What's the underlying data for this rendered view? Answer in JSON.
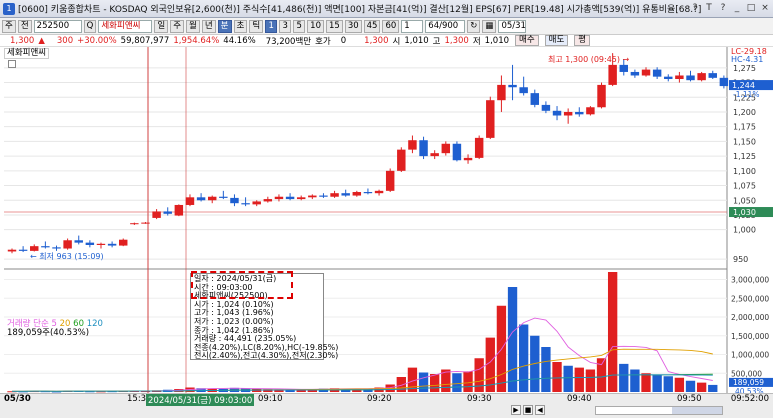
{
  "window": {
    "title": "[0600] 키움종합차트 - KOSDAQ 외국인보유[2,600(천)] 주식수[41,486(천)] 액면[100] 자본금[41(억)] 결산[12월] EPS[67] PER[19.48] 시가총액[539(억)] 유통비율[68.?]",
    "buttons": [
      "?",
      "T",
      "?",
      "_",
      "□",
      "×"
    ]
  },
  "toolbar": {
    "type_label": "주",
    "market_label": "전",
    "code": "252500",
    "q_label": "Q",
    "name": "세화피앤씨",
    "periods": [
      "일",
      "주",
      "월",
      "년",
      "분",
      "초",
      "틱"
    ],
    "active_period": "분",
    "intervals": [
      "1",
      "3",
      "5",
      "10",
      "15",
      "30",
      "45",
      "60"
    ],
    "interval_value": "1",
    "count": "64/900",
    "date": "05/31"
  },
  "quote": {
    "price": "1,300",
    "change": "300",
    "change_pct": "+30.00%",
    "volume": "59,807,977",
    "volume_pct": "1,954.64%",
    "turnover": "44.16%",
    "amount": "73,200백만",
    "hoga_label": "호가",
    "hoga_value": "0",
    "hoga_price": "1,300",
    "open_label": "시",
    "open": "1,010",
    "high_label": "고",
    "high": "1,300",
    "low_label": "저",
    "low": "1,010",
    "buy_label": "매수",
    "sell_label": "매도",
    "eval_label": "평"
  },
  "chart_labels": {
    "legend_name": "세화피앤씨",
    "high_annotation": "최고 1,300 (09:45)",
    "low_annotation": "최저 963 (15:09)",
    "lc_label": "LC-29.18",
    "hc_label": "HC-4.31",
    "current_price": "1,244",
    "current_pct": "-1.11%",
    "ref_price": "1,030",
    "vol_legend_a": "거래량",
    "vol_legend_b": "단순",
    "vol_legend_c": "5",
    "vol_legend_d": "20",
    "vol_legend_e": "60",
    "vol_legend_f": "120",
    "vol_legend_value": "189,059주(40.53%)",
    "vol_current": "189,059",
    "vol_current_pct": "40.53%"
  },
  "tooltip": {
    "date": "일자      : 2024/05/31(금)",
    "time": "시간      : 09:03:00",
    "name": "세화피앤씨(252500)",
    "open": "시가      : 1,024 (0.10%)",
    "high": "고가      : 1,043 (1.96%)",
    "low": "저가      : 1,023 (0.00%)",
    "close": "종가      : 1,042 (1.86%)",
    "volume": "거래량    : 44,491 (235.05%)",
    "extra1": "전종(4.20%),LC(8.20%),HC(-19.85%)",
    "extra2": "전시(2.40%),전고(4.30%),전저(2.30%)"
  },
  "time_axis": {
    "date_label": "05/30",
    "labels": [
      "15:30",
      "09:10",
      "09:20",
      "09:30",
      "09:40",
      "09:50"
    ],
    "highlight": "2024/05/31(금) 09:03:00",
    "end_time": "09:52:00"
  },
  "chart_data": [
    {
      "type": "candlestick",
      "title": "",
      "y_ticks": [
        950,
        1000,
        1025,
        1050,
        1075,
        1100,
        1125,
        1150,
        1175,
        1200,
        1225,
        1250,
        1275
      ],
      "ylim": [
        940,
        1290
      ],
      "colors": {
        "up": "#e02020",
        "down": "#1e5fd0"
      },
      "candles": [
        {
          "o": 963,
          "h": 968,
          "l": 960,
          "c": 966
        },
        {
          "o": 966,
          "h": 972,
          "l": 962,
          "c": 964
        },
        {
          "o": 964,
          "h": 975,
          "l": 963,
          "c": 972
        },
        {
          "o": 972,
          "h": 980,
          "l": 968,
          "c": 970
        },
        {
          "o": 970,
          "h": 973,
          "l": 964,
          "c": 968
        },
        {
          "o": 968,
          "h": 985,
          "l": 966,
          "c": 982
        },
        {
          "o": 982,
          "h": 990,
          "l": 975,
          "c": 978
        },
        {
          "o": 978,
          "h": 982,
          "l": 970,
          "c": 974
        },
        {
          "o": 974,
          "h": 978,
          "l": 968,
          "c": 976
        },
        {
          "o": 976,
          "h": 980,
          "l": 970,
          "c": 973
        },
        {
          "o": 973,
          "h": 985,
          "l": 972,
          "c": 983
        },
        {
          "o": 1010,
          "h": 1012,
          "l": 1008,
          "c": 1011
        },
        {
          "o": 1011,
          "h": 1013,
          "l": 1010,
          "c": 1012
        },
        {
          "o": 1020,
          "h": 1035,
          "l": 1018,
          "c": 1031
        },
        {
          "o": 1031,
          "h": 1038,
          "l": 1024,
          "c": 1027
        },
        {
          "o": 1024,
          "h": 1043,
          "l": 1023,
          "c": 1042
        },
        {
          "o": 1042,
          "h": 1060,
          "l": 1040,
          "c": 1055
        },
        {
          "o": 1055,
          "h": 1062,
          "l": 1048,
          "c": 1050
        },
        {
          "o": 1050,
          "h": 1058,
          "l": 1045,
          "c": 1056
        },
        {
          "o": 1056,
          "h": 1066,
          "l": 1052,
          "c": 1054
        },
        {
          "o": 1054,
          "h": 1060,
          "l": 1040,
          "c": 1045
        },
        {
          "o": 1045,
          "h": 1055,
          "l": 1040,
          "c": 1043
        },
        {
          "o": 1043,
          "h": 1050,
          "l": 1040,
          "c": 1048
        },
        {
          "o": 1048,
          "h": 1056,
          "l": 1046,
          "c": 1052
        },
        {
          "o": 1052,
          "h": 1060,
          "l": 1048,
          "c": 1056
        },
        {
          "o": 1056,
          "h": 1062,
          "l": 1050,
          "c": 1052
        },
        {
          "o": 1052,
          "h": 1058,
          "l": 1050,
          "c": 1055
        },
        {
          "o": 1055,
          "h": 1060,
          "l": 1052,
          "c": 1058
        },
        {
          "o": 1058,
          "h": 1062,
          "l": 1054,
          "c": 1056
        },
        {
          "o": 1056,
          "h": 1066,
          "l": 1054,
          "c": 1062
        },
        {
          "o": 1062,
          "h": 1068,
          "l": 1056,
          "c": 1058
        },
        {
          "o": 1058,
          "h": 1066,
          "l": 1056,
          "c": 1064
        },
        {
          "o": 1064,
          "h": 1070,
          "l": 1060,
          "c": 1062
        },
        {
          "o": 1062,
          "h": 1068,
          "l": 1058,
          "c": 1066
        },
        {
          "o": 1066,
          "h": 1104,
          "l": 1064,
          "c": 1100
        },
        {
          "o": 1100,
          "h": 1140,
          "l": 1098,
          "c": 1136
        },
        {
          "o": 1136,
          "h": 1160,
          "l": 1130,
          "c": 1152
        },
        {
          "o": 1152,
          "h": 1158,
          "l": 1120,
          "c": 1125
        },
        {
          "o": 1125,
          "h": 1135,
          "l": 1120,
          "c": 1130
        },
        {
          "o": 1130,
          "h": 1150,
          "l": 1126,
          "c": 1146
        },
        {
          "o": 1146,
          "h": 1150,
          "l": 1116,
          "c": 1118
        },
        {
          "o": 1118,
          "h": 1128,
          "l": 1112,
          "c": 1122
        },
        {
          "o": 1122,
          "h": 1160,
          "l": 1120,
          "c": 1156
        },
        {
          "o": 1156,
          "h": 1226,
          "l": 1154,
          "c": 1220
        },
        {
          "o": 1220,
          "h": 1262,
          "l": 1200,
          "c": 1246
        },
        {
          "o": 1246,
          "h": 1280,
          "l": 1220,
          "c": 1242
        },
        {
          "o": 1242,
          "h": 1260,
          "l": 1228,
          "c": 1232
        },
        {
          "o": 1232,
          "h": 1238,
          "l": 1208,
          "c": 1212
        },
        {
          "o": 1212,
          "h": 1218,
          "l": 1198,
          "c": 1202
        },
        {
          "o": 1202,
          "h": 1210,
          "l": 1186,
          "c": 1194
        },
        {
          "o": 1194,
          "h": 1206,
          "l": 1180,
          "c": 1200
        },
        {
          "o": 1200,
          "h": 1208,
          "l": 1192,
          "c": 1196
        },
        {
          "o": 1196,
          "h": 1210,
          "l": 1194,
          "c": 1208
        },
        {
          "o": 1208,
          "h": 1250,
          "l": 1206,
          "c": 1246
        },
        {
          "o": 1246,
          "h": 1300,
          "l": 1244,
          "c": 1280
        },
        {
          "o": 1280,
          "h": 1290,
          "l": 1262,
          "c": 1268
        },
        {
          "o": 1268,
          "h": 1272,
          "l": 1258,
          "c": 1262
        },
        {
          "o": 1262,
          "h": 1276,
          "l": 1260,
          "c": 1272
        },
        {
          "o": 1272,
          "h": 1276,
          "l": 1256,
          "c": 1260
        },
        {
          "o": 1260,
          "h": 1264,
          "l": 1252,
          "c": 1256
        },
        {
          "o": 1256,
          "h": 1268,
          "l": 1250,
          "c": 1262
        },
        {
          "o": 1262,
          "h": 1270,
          "l": 1252,
          "c": 1254
        },
        {
          "o": 1254,
          "h": 1268,
          "l": 1252,
          "c": 1266
        },
        {
          "o": 1266,
          "h": 1270,
          "l": 1256,
          "c": 1258
        },
        {
          "o": 1258,
          "h": 1262,
          "l": 1240,
          "c": 1244
        }
      ]
    },
    {
      "type": "bar",
      "title": "거래량",
      "y_ticks": [
        500000,
        1000000,
        1500000,
        2000000,
        2500000,
        3000000
      ],
      "y_tick_labels": [
        "500,000",
        "1,000,000",
        "1,500,000",
        "2,000,000",
        "2,500,000",
        "3,000,000"
      ],
      "ylim": [
        0,
        3200000
      ],
      "values": [
        20000,
        18000,
        25000,
        22000,
        15000,
        30000,
        28000,
        20000,
        18000,
        22000,
        26000,
        30000,
        25000,
        44491,
        60000,
        80000,
        120000,
        100000,
        90000,
        85000,
        110000,
        95000,
        80000,
        75000,
        70000,
        65000,
        70000,
        80000,
        90000,
        100000,
        85000,
        90000,
        80000,
        120000,
        200000,
        400000,
        650000,
        520000,
        480000,
        600000,
        500000,
        550000,
        900000,
        1450000,
        2300000,
        2800000,
        1800000,
        1500000,
        1200000,
        800000,
        700000,
        650000,
        600000,
        900000,
        3200000,
        750000,
        600000,
        500000,
        450000,
        420000,
        380000,
        300000,
        250000,
        189059
      ],
      "up": [
        1,
        0,
        1,
        0,
        0,
        1,
        0,
        0,
        1,
        0,
        1,
        1,
        1,
        1,
        0,
        1,
        1,
        0,
        1,
        0,
        0,
        0,
        1,
        1,
        1,
        0,
        1,
        1,
        0,
        1,
        0,
        1,
        0,
        1,
        1,
        1,
        1,
        0,
        1,
        1,
        0,
        1,
        1,
        1,
        1,
        0,
        0,
        0,
        0,
        1,
        0,
        1,
        1,
        1,
        1,
        0,
        0,
        1,
        0,
        0,
        1,
        0,
        1,
        0
      ],
      "ma_series": [
        {
          "name": "5",
          "color": "#e060e0"
        },
        {
          "name": "20",
          "color": "#e0a000"
        },
        {
          "name": "60",
          "color": "#20a020"
        },
        {
          "name": "120",
          "color": "#2090c0"
        }
      ]
    }
  ]
}
